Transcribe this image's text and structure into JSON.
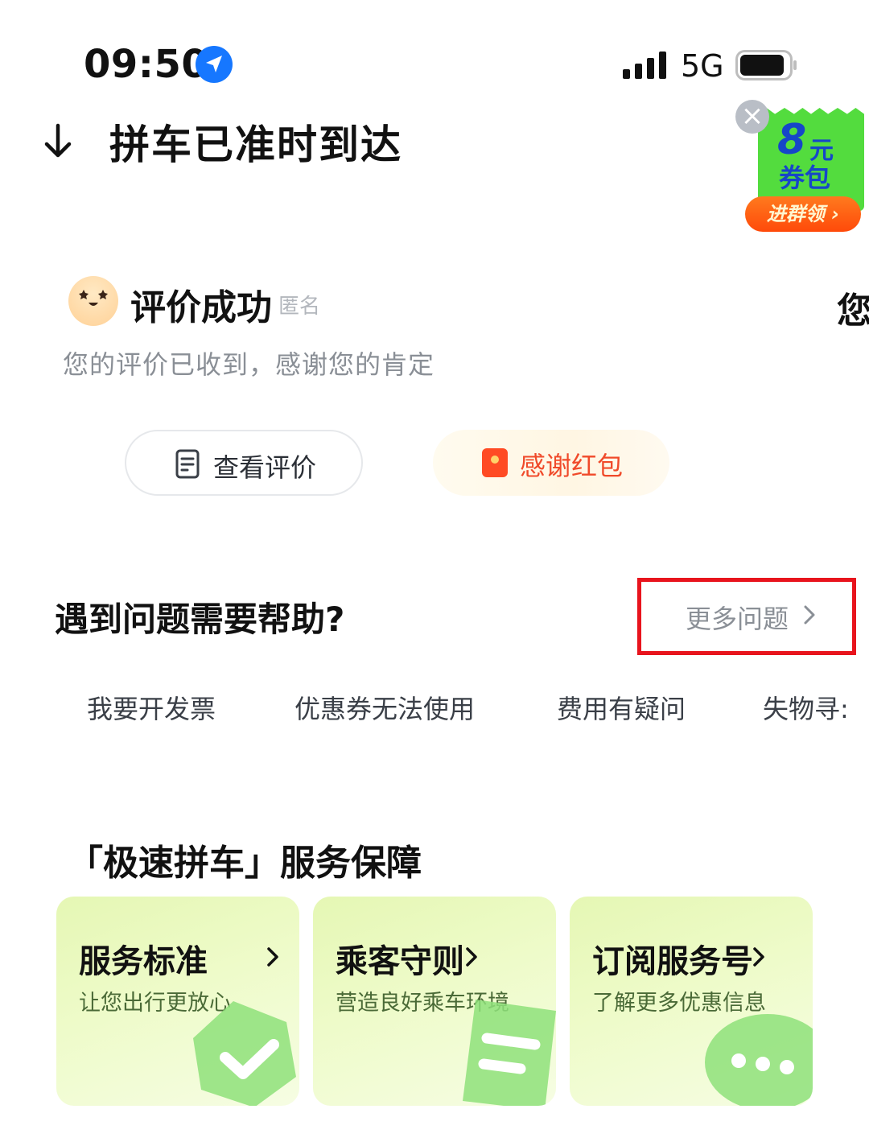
{
  "status_bar": {
    "time": "09:50",
    "network": "5G",
    "icons": [
      "location-arrow-icon",
      "signal-icon",
      "battery-icon"
    ]
  },
  "header": {
    "title": "拼车已准时到达",
    "back_icon": "arrow-down-icon"
  },
  "promo": {
    "amount": "8",
    "unit": "元",
    "subtitle": "券包",
    "button_label": "进群领 ›",
    "close_icon": "close-icon",
    "colors": {
      "card": "#53dc3e",
      "text": "#1646c9",
      "button": "#ff5a12"
    }
  },
  "review": {
    "title": "评价成功",
    "anonymous_tag": "匿名",
    "peek_text": "您",
    "description": "您的评价已收到，感谢您的肯定",
    "view_button": "查看评价",
    "redpack_button": "感谢红包"
  },
  "help": {
    "title": "遇到问题需要帮助?",
    "more_link": "更多问题",
    "quick_items": [
      "我要开发票",
      "优惠券无法使用",
      "费用有疑问",
      "失物寻:"
    ]
  },
  "service": {
    "title": "「极速拼车」服务保障",
    "cards": [
      {
        "title": "服务标准",
        "subtitle": "让您出行更放心",
        "icon": "check-shield-icon"
      },
      {
        "title": "乘客守则",
        "subtitle": "营造良好乘车环境",
        "icon": "document-icon"
      },
      {
        "title": "订阅服务号",
        "subtitle": "了解更多优惠信息",
        "icon": "chat-bubble-icon"
      }
    ]
  },
  "colors": {
    "accent_red": "#e8141d",
    "redpack_text": "#f04a2a",
    "card_green": "#e8f8bd",
    "muted_text": "#8a8f96"
  }
}
